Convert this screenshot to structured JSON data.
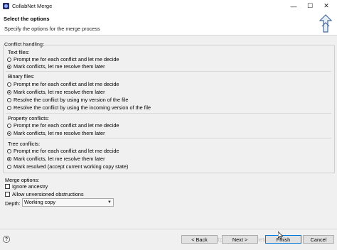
{
  "window": {
    "title": "CollabNet Merge",
    "controls": {
      "minimize": "—",
      "maximize": "☐",
      "close": "✕"
    }
  },
  "header": {
    "title": "Select the options",
    "description": "Specify the options for the merge process",
    "icon": "merge-arrow-icon"
  },
  "conflict_handling": {
    "label": "Conflict handling:",
    "text_files": {
      "label": "Text files:",
      "options": [
        {
          "label": "Prompt me for each conflict and let me decide",
          "selected": false
        },
        {
          "label": "Mark conflicts, let me resolve them later",
          "selected": true
        }
      ]
    },
    "binary_files": {
      "label": "Binary files:",
      "options": [
        {
          "label": "Prompt me for each conflict and let me decide",
          "selected": false
        },
        {
          "label": "Mark conflicts, let me resolve them later",
          "selected": true
        },
        {
          "label": "Resolve the conflict by using my version of the file",
          "selected": false
        },
        {
          "label": "Resolve the conflict by using the incoming version of the file",
          "selected": false
        }
      ]
    },
    "property_conflicts": {
      "label": "Property conflicts:",
      "options": [
        {
          "label": "Prompt me for each conflict and let me decide",
          "selected": false
        },
        {
          "label": "Mark conflicts, let me resolve them later",
          "selected": true
        }
      ]
    },
    "tree_conflicts": {
      "label": "Tree conflicts:",
      "options": [
        {
          "label": "Prompt me for each conflict and let me decide",
          "selected": false
        },
        {
          "label": "Mark conflicts, let me resolve them later",
          "selected": true
        },
        {
          "label": "Mark resolved (accept current working copy state)",
          "selected": false
        }
      ]
    }
  },
  "merge_options": {
    "label": "Merge options:",
    "ignore_ancestry": {
      "label": "Ignore ancestry",
      "checked": false
    },
    "allow_unversioned": {
      "label": "Allow unversioned obstructions",
      "checked": false
    },
    "depth": {
      "label": "Depth:",
      "value": "Working copy"
    }
  },
  "footer": {
    "help": "?",
    "back": "< Back",
    "next": "Next >",
    "finish": "Finish",
    "cancel": "Cancel",
    "watermark": "https://blog.csdn.net/u012458"
  },
  "colors": {
    "finish_border": "#0078d7",
    "header_bg": "#ffffff",
    "dialog_bg": "#f0f0f0"
  }
}
